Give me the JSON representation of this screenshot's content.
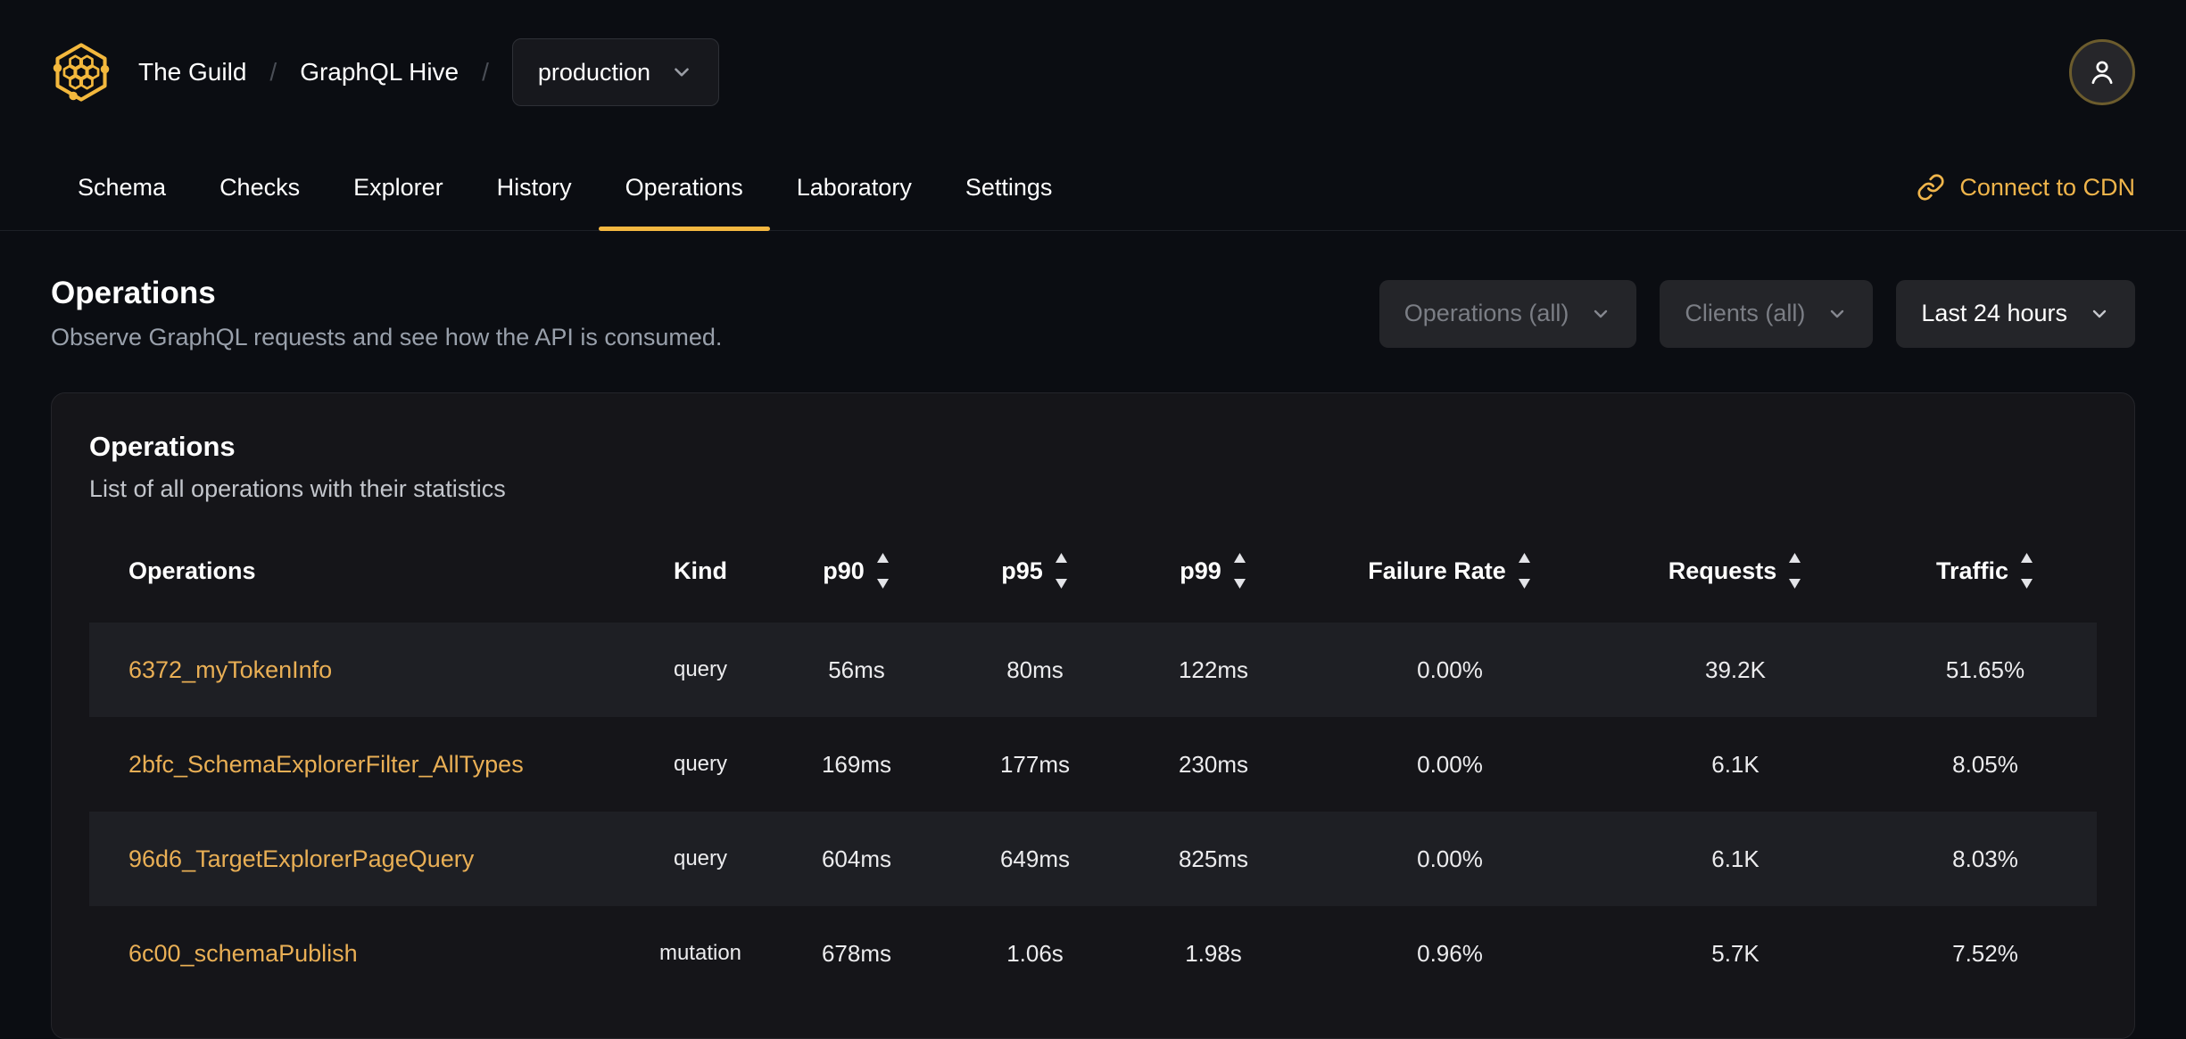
{
  "brand": {
    "org": "The Guild",
    "project": "GraphQL Hive",
    "separator": "/",
    "target": "production"
  },
  "nav": {
    "tabs": [
      {
        "label": "Schema"
      },
      {
        "label": "Checks"
      },
      {
        "label": "Explorer"
      },
      {
        "label": "History"
      },
      {
        "label": "Operations"
      },
      {
        "label": "Laboratory"
      },
      {
        "label": "Settings"
      }
    ],
    "active_tab": "Operations",
    "cdn_label": "Connect to CDN"
  },
  "page": {
    "title": "Operations",
    "subtitle": "Observe GraphQL requests and see how the API is consumed."
  },
  "filters": {
    "operations_label": "Operations (all)",
    "clients_label": "Clients (all)",
    "period_label": "Last 24 hours"
  },
  "card": {
    "title": "Operations",
    "subtitle": "List of all operations with their statistics"
  },
  "table": {
    "columns": [
      {
        "key": "name",
        "label": "Operations",
        "sortable": false,
        "align": "left"
      },
      {
        "key": "kind",
        "label": "Kind",
        "sortable": false,
        "align": "center"
      },
      {
        "key": "p90",
        "label": "p90",
        "sortable": true,
        "align": "center"
      },
      {
        "key": "p95",
        "label": "p95",
        "sortable": true,
        "align": "center"
      },
      {
        "key": "p99",
        "label": "p99",
        "sortable": true,
        "align": "center"
      },
      {
        "key": "failure_rate",
        "label": "Failure Rate",
        "sortable": true,
        "align": "center"
      },
      {
        "key": "requests",
        "label": "Requests",
        "sortable": true,
        "align": "center"
      },
      {
        "key": "traffic",
        "label": "Traffic",
        "sortable": true,
        "align": "center"
      }
    ],
    "rows": [
      {
        "name": "6372_myTokenInfo",
        "kind": "query",
        "p90": "56ms",
        "p95": "80ms",
        "p99": "122ms",
        "failure_rate": "0.00%",
        "requests": "39.2K",
        "traffic": "51.65%"
      },
      {
        "name": "2bfc_SchemaExplorerFilter_AllTypes",
        "kind": "query",
        "p90": "169ms",
        "p95": "177ms",
        "p99": "230ms",
        "failure_rate": "0.00%",
        "requests": "6.1K",
        "traffic": "8.05%"
      },
      {
        "name": "96d6_TargetExplorerPageQuery",
        "kind": "query",
        "p90": "604ms",
        "p95": "649ms",
        "p99": "825ms",
        "failure_rate": "0.00%",
        "requests": "6.1K",
        "traffic": "8.03%"
      },
      {
        "name": "6c00_schemaPublish",
        "kind": "mutation",
        "p90": "678ms",
        "p95": "1.06s",
        "p99": "1.98s",
        "failure_rate": "0.96%",
        "requests": "5.7K",
        "traffic": "7.52%"
      }
    ]
  },
  "icons": {
    "logo": "hive-honeycomb-logo",
    "breadcrumb_chevron": "chevron-down",
    "cdn": "link-chain",
    "avatar": "person",
    "sort": "sort-arrows-up-down"
  },
  "colors": {
    "accent_gold": "#f4b740",
    "link_gold": "#e9af55",
    "cdn_gold": "#f0b54b",
    "page_bg": "#0b0d12",
    "card_bg": "#151519",
    "row_stripe_bg": "#1e1f24",
    "muted_text": "#99a0ab",
    "dimmed_filter_text": "#7b7e85"
  }
}
